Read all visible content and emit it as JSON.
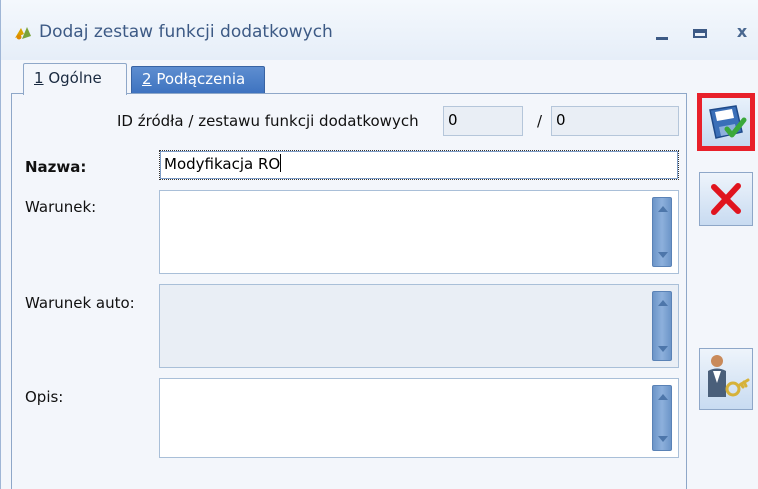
{
  "window": {
    "title": "Dodaj zestaw funkcji dodatkowych",
    "minimize": "–",
    "close": "x"
  },
  "tabs": [
    {
      "key": "1",
      "label": "Ogólne",
      "active": true
    },
    {
      "key": "2",
      "label": "Podłączenia",
      "active": false
    }
  ],
  "form": {
    "id_label": "ID źródła / zestawu funkcji dodatkowych",
    "id_value1": "0",
    "separator": "/",
    "id_value2": "0",
    "nazwa_label": "Nazwa:",
    "nazwa_value": "Modyfikacja RO",
    "warunek_label": "Warunek:",
    "warunek_value": "",
    "warunek_auto_label": "Warunek auto:",
    "warunek_auto_value": "",
    "opis_label": "Opis:",
    "opis_value": ""
  },
  "toolbar": {
    "save_icon": "floppy-check-icon",
    "cancel_icon": "red-x-icon",
    "permissions_icon": "person-key-icon"
  },
  "colors": {
    "title_text": "#3d5a85",
    "tab_active_bg": "#f3f6fb",
    "tab_inactive_bg": "#4a7fc6",
    "highlight_border": "#e8202a",
    "cancel_red": "#e0141e"
  }
}
